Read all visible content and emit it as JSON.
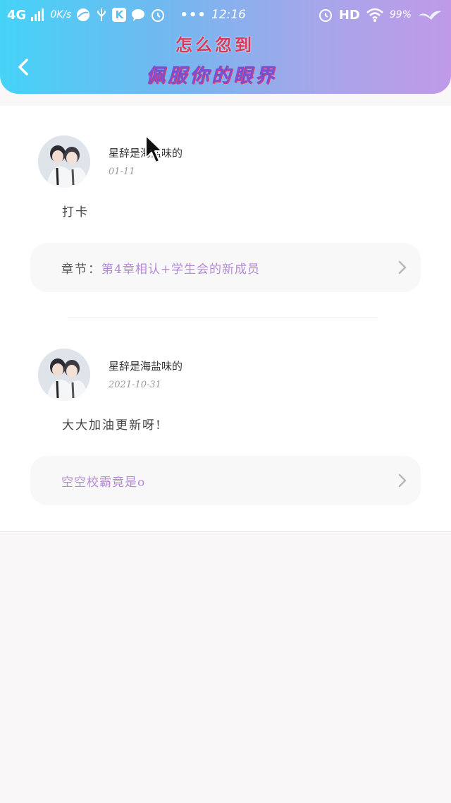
{
  "status_bar": {
    "network": "4G",
    "speed": "0K/s",
    "time": "12:16",
    "hd": "HD",
    "battery": "99%",
    "k_label": "K",
    "more": "•••"
  },
  "header": {
    "back_icon": "chevron-left-icon",
    "logo_line1": "怎么忽到",
    "logo_line2": "佩服你的眼界",
    "gradient": [
      "#45d3f7",
      "#c09ae8"
    ]
  },
  "comments": [
    {
      "username": "星辞是海盐味的",
      "date": "01-11",
      "text": "打卡",
      "chapter_prefix": "章节：",
      "chapter_title": "第4章相认+学生会的新成员"
    },
    {
      "username": "星辞是海盐味的",
      "date": "2021-10-31",
      "text": "大大加油更新呀!",
      "chapter_prefix": "",
      "chapter_title": "空空校霸竟是o"
    }
  ],
  "colors": {
    "accent_purple": "#b58bd8",
    "card_bg": "#ffffff",
    "page_bg": "#f9f7f8"
  }
}
